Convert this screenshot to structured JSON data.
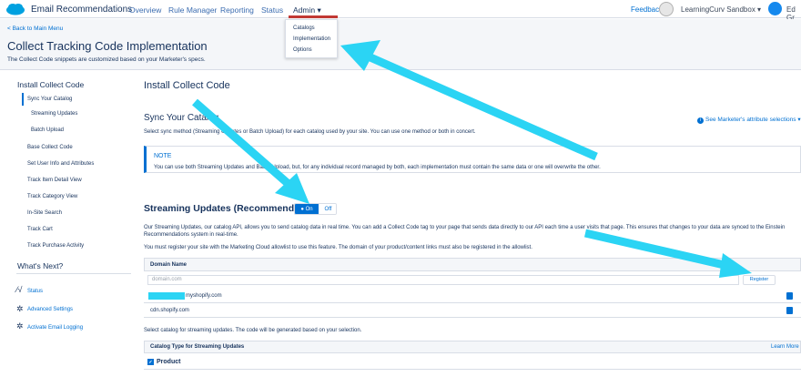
{
  "topbar": {
    "app_name": "Email Recommendations",
    "nav": [
      "Overview",
      "Rule Manager",
      "Reporting",
      "Status"
    ],
    "admin_label": "Admin ▾",
    "feedback": "Feedback",
    "account": "LearningCurv Sandbox ▾",
    "user": "Ed Gr"
  },
  "admin_menu": [
    "Catalogs",
    "Implementation",
    "Options"
  ],
  "header": {
    "back_link": "< Back to Main Menu",
    "title": "Collect Tracking Code Implementation",
    "subtitle": "The Collect Code snippets are customized based on your Marketer's specs."
  },
  "sidebar": {
    "heading": "Install Collect Code",
    "items": [
      "Sync Your Catalog",
      "Streaming Updates",
      "Batch Upload",
      "Base Collect Code",
      "Set User Info and Attributes",
      "Track Item Detail View",
      "Track Category View",
      "In-Site Search",
      "Track Cart",
      "Track Purchase Activity"
    ],
    "next_heading": "What's Next?",
    "next_items": [
      "Status",
      "Advanced Settings",
      "Activate Email Logging"
    ]
  },
  "main": {
    "heading": "Install Collect Code",
    "sync_heading": "Sync Your Catalog",
    "sync_desc": "Select sync method (Streaming Updates or Batch Upload) for each catalog used by your site. You can use one method or both in concert.",
    "attr_link": "See Marketer's attribute selections",
    "note_title": "NOTE",
    "note_body": "You can use both Streaming Updates and Batch Upload, but, for any individual record managed by both, each implementation must contain the same data or one will overwrite the other.",
    "streaming_heading": "Streaming Updates (Recommended)",
    "toggle_on": "On",
    "toggle_off": "Off",
    "streaming_desc_1": "Our Streaming Updates, our catalog API, allows you to send catalog data in real time. You can add a Collect Code tag to your page that sends data directly to our API each time a user visits that page. This ensures that changes to your data are synced to the Einstein",
    "streaming_desc_2": "Recommendations system in real-time.",
    "register_desc": "You must register your site with the Marketing Cloud allowlist to use this feature. The domain of your product/content links must also be registered in the allowlist.",
    "domain_header": "Domain Name",
    "domain_placeholder": "domain.com",
    "register_button": "Register",
    "domains": [
      "myshopify.com",
      "cdn.shopify.com"
    ],
    "catalog_desc": "Select catalog for streaming updates. The code will be generated based on your selection.",
    "catalog_header": "Catalog Type for Streaming Updates",
    "learn_more": "Learn More",
    "catalog_item": "Product"
  },
  "colors": {
    "accent": "#0070d2",
    "arrow": "#2bd4f4",
    "admin_underline": "#c23934"
  }
}
